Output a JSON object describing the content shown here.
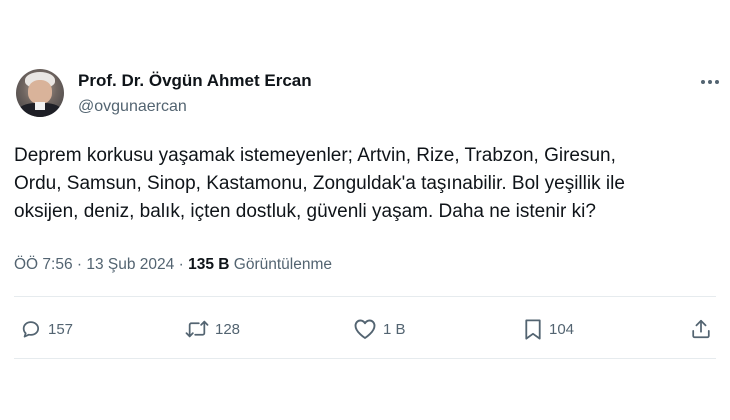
{
  "author": {
    "name": "Prof. Dr. Övgün Ahmet Ercan",
    "handle": "@ovgunaercan"
  },
  "tweet": {
    "lines": [
      "Deprem korkusu yaşamak istemeyenler; Artvin, Rize, Trabzon, Giresun,",
      "Ordu, Samsun, Sinop, Kastamonu, Zonguldak'a taşınabilir. Bol yeşillik ile",
      "oksijen, deniz, balık, içten dostluk, güvenli yaşam. Daha ne istenir ki?"
    ]
  },
  "meta": {
    "time": "ÖÖ 7:56",
    "separator1": " · ",
    "date": "13 Şub 2024",
    "separator2": " · ",
    "views_count": "135 B",
    "views_label": "Görüntülenme"
  },
  "actions": {
    "replies": "157",
    "retweets": "128",
    "likes": "1 B",
    "bookmarks": "104"
  },
  "icons": {
    "more": "more-horizontal-icon",
    "reply": "reply-bubble-icon",
    "retweet": "retweet-icon",
    "like": "heart-icon",
    "bookmark": "bookmark-icon",
    "share": "share-upload-icon"
  },
  "colors": {
    "text": "#0f1419",
    "secondary": "#536471",
    "divider": "#e6ebee"
  }
}
